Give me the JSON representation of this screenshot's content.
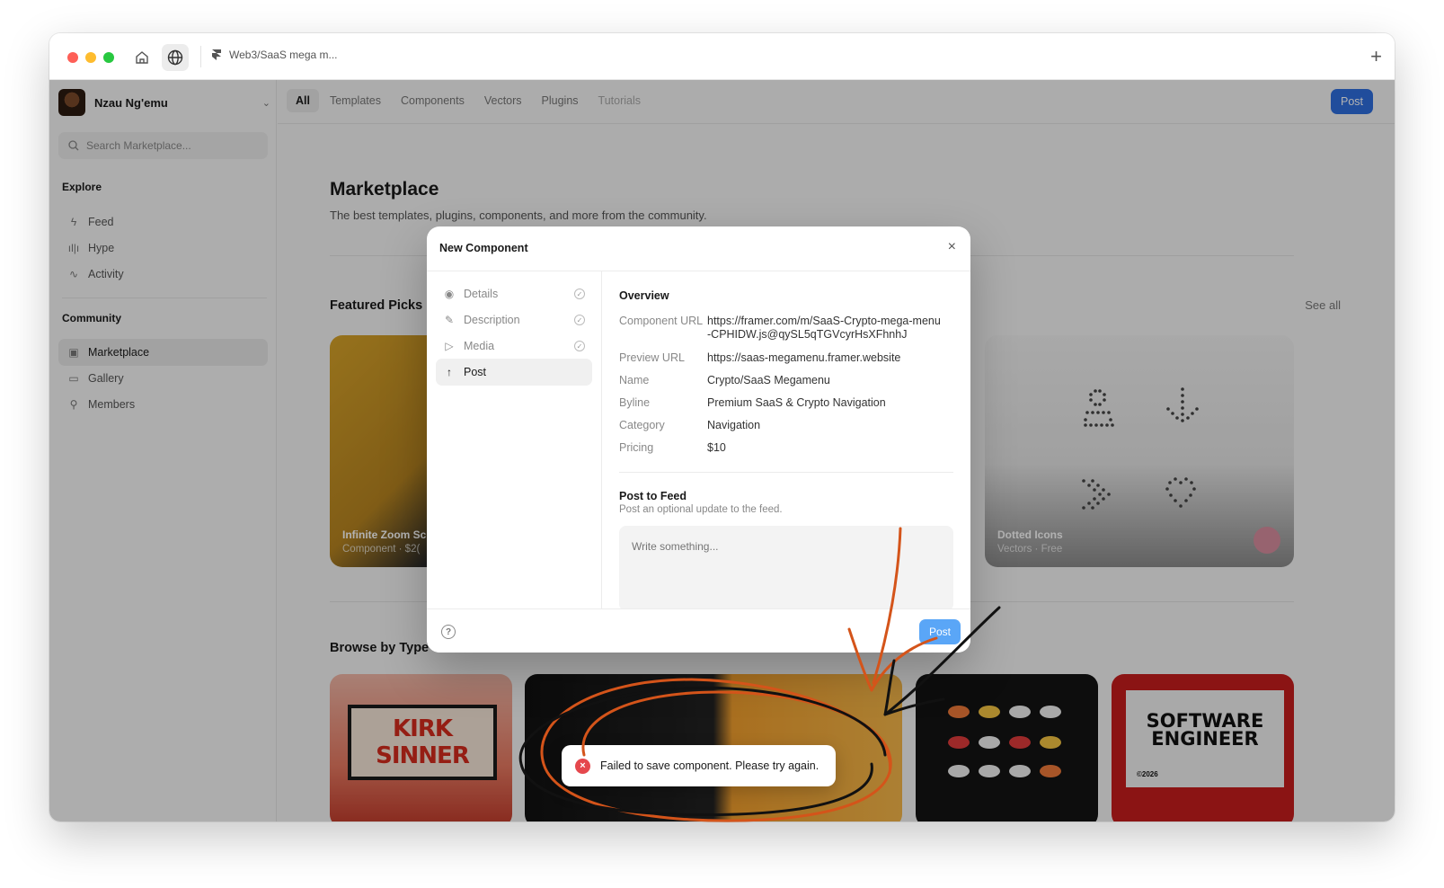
{
  "browser": {
    "tab_title": "Web3/SaaS mega m..."
  },
  "user": {
    "name": "Nzau Ng'emu"
  },
  "search": {
    "placeholder": "Search Marketplace..."
  },
  "sidebar": {
    "explore_label": "Explore",
    "explore_items": [
      {
        "label": "Feed",
        "icon": "bolt-icon"
      },
      {
        "label": "Hype",
        "icon": "bars-icon"
      },
      {
        "label": "Activity",
        "icon": "activity-icon"
      }
    ],
    "community_label": "Community",
    "community_items": [
      {
        "label": "Marketplace",
        "icon": "store-icon",
        "active": true
      },
      {
        "label": "Gallery",
        "icon": "monitor-icon"
      },
      {
        "label": "Members",
        "icon": "person-icon"
      }
    ]
  },
  "topnav": {
    "tabs": [
      "All",
      "Templates",
      "Components",
      "Vectors",
      "Plugins",
      "Tutorials"
    ],
    "active": "All",
    "post_label": "Post"
  },
  "marketplace": {
    "title": "Marketplace",
    "subtitle": "The best templates, plugins, components, and more from the community.",
    "featured_title": "Featured Picks",
    "see_all": "See all",
    "browse_title": "Browse by Type",
    "featured_cards": [
      {
        "title": "Infinite Zoom Sc",
        "subtitle": "Component · $2("
      },
      {
        "title": "Dotted Icons",
        "subtitle": "Vectors · Free"
      }
    ],
    "browse_cards": [
      {
        "text": "KIRK SINNER"
      },
      {
        "text": ""
      },
      {
        "text": ""
      },
      {
        "text": "SOFTWARE ENGINEER",
        "sub": "©2026"
      }
    ]
  },
  "modal": {
    "title": "New Component",
    "steps": [
      {
        "label": "Details",
        "done": true
      },
      {
        "label": "Description",
        "done": true
      },
      {
        "label": "Media",
        "done": true
      },
      {
        "label": "Post",
        "active": true
      }
    ],
    "overview_title": "Overview",
    "fields": [
      {
        "key": "Component URL",
        "value": "https://framer.com/m/SaaS-Crypto-mega-menu-CPHIDW.js@qySL5qTGVcyrHsXFhnhJ"
      },
      {
        "key": "Preview URL",
        "value": "https://saas-megamenu.framer.website"
      },
      {
        "key": "Name",
        "value": "Crypto/SaaS Megamenu"
      },
      {
        "key": "Byline",
        "value": "Premium SaaS & Crypto Navigation"
      },
      {
        "key": "Category",
        "value": "Navigation"
      },
      {
        "key": "Pricing",
        "value": "$10"
      }
    ],
    "post_to_feed_title": "Post to Feed",
    "post_to_feed_sub": "Post an optional update to the feed.",
    "textarea_placeholder": "Write something...",
    "post_label": "Post"
  },
  "toast": {
    "message": "Failed to save component. Please try again."
  },
  "colors": {
    "accent": "#2f6fe0",
    "modal_post": "#5aa6f7",
    "error": "#e5484d",
    "scribble_orange": "#d4541a",
    "scribble_black": "#111111"
  }
}
